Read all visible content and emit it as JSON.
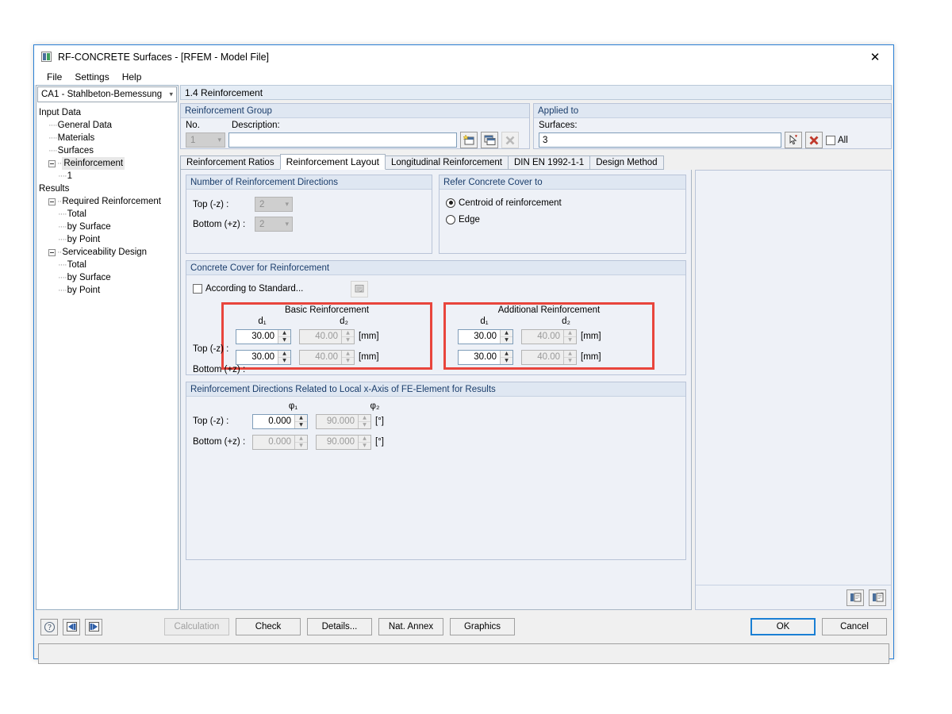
{
  "window": {
    "title": "RF-CONCRETE Surfaces - [RFEM - Model File]",
    "close_label": "✕",
    "icon": "app-icon"
  },
  "menu": {
    "items": [
      "File",
      "Settings",
      "Help"
    ]
  },
  "sidebar": {
    "combo_value": "CA1 - Stahlbeton-Bemessung",
    "tree": [
      {
        "label": "Input Data",
        "depth": 0,
        "expander": false,
        "dash": false,
        "selected": false
      },
      {
        "label": "General Data",
        "depth": 1,
        "expander": false,
        "dash": true,
        "selected": false
      },
      {
        "label": "Materials",
        "depth": 1,
        "expander": false,
        "dash": true,
        "selected": false
      },
      {
        "label": "Surfaces",
        "depth": 1,
        "expander": false,
        "dash": true,
        "selected": false
      },
      {
        "label": "Reinforcement",
        "depth": 1,
        "expander": true,
        "dash": true,
        "selected": true
      },
      {
        "label": "1",
        "depth": 2,
        "expander": false,
        "dash": true,
        "selected": false
      },
      {
        "label": "Results",
        "depth": 0,
        "expander": false,
        "dash": false,
        "selected": false
      },
      {
        "label": "Required Reinforcement",
        "depth": 1,
        "expander": true,
        "dash": true,
        "selected": false
      },
      {
        "label": "Total",
        "depth": 2,
        "expander": false,
        "dash": true,
        "selected": false
      },
      {
        "label": "by Surface",
        "depth": 2,
        "expander": false,
        "dash": true,
        "selected": false
      },
      {
        "label": "by Point",
        "depth": 2,
        "expander": false,
        "dash": true,
        "selected": false
      },
      {
        "label": "Serviceability Design",
        "depth": 1,
        "expander": true,
        "dash": true,
        "selected": false
      },
      {
        "label": "Total",
        "depth": 2,
        "expander": false,
        "dash": true,
        "selected": false
      },
      {
        "label": "by Surface",
        "depth": 2,
        "expander": false,
        "dash": true,
        "selected": false
      },
      {
        "label": "by Point",
        "depth": 2,
        "expander": false,
        "dash": true,
        "selected": false
      }
    ]
  },
  "page": {
    "title": "1.4 Reinforcement"
  },
  "reinforcement_group": {
    "title": "Reinforcement Group",
    "no_label": "No.",
    "no_value": "1",
    "description_label": "Description:",
    "description_value": "",
    "buttons": [
      "new-icon",
      "copy-icon",
      "delete-icon"
    ]
  },
  "applied_to": {
    "title": "Applied to",
    "surfaces_label": "Surfaces:",
    "surfaces_value": "3",
    "pick_icon": "pick-cursor-icon",
    "clear_icon": "red-x-icon",
    "all_label": "All",
    "all_checked": false
  },
  "tabs": [
    {
      "label": "Reinforcement Ratios",
      "active": false
    },
    {
      "label": "Reinforcement Layout",
      "active": true
    },
    {
      "label": "Longitudinal Reinforcement",
      "active": false
    },
    {
      "label": "DIN EN 1992-1-1",
      "active": false
    },
    {
      "label": "Design Method",
      "active": false
    }
  ],
  "directions": {
    "title": "Number of Reinforcement Directions",
    "rows": [
      {
        "label": "Top (-z) :",
        "value": "2",
        "enabled": false
      },
      {
        "label": "Bottom (+z) :",
        "value": "2",
        "enabled": false
      }
    ]
  },
  "refer_cover": {
    "title": "Refer Concrete Cover to",
    "options": [
      {
        "label": "Centroid of reinforcement",
        "selected": true
      },
      {
        "label": "Edge",
        "selected": false
      }
    ]
  },
  "concrete_cover": {
    "title": "Concrete Cover for Reinforcement",
    "standard_checkbox_label": "According to Standard...",
    "standard_checked": false,
    "standard_button_icon": "standard-settings-icon",
    "groups": [
      {
        "name": "Basic Reinforcement",
        "highlighted": true,
        "col1": "d₁",
        "col2": "d₂",
        "rows": [
          {
            "label": "Top (-z) :",
            "d1": "30.00",
            "d1_enabled": true,
            "d2": "40.00",
            "d2_enabled": false,
            "unit": "[mm]"
          },
          {
            "label": "Bottom (+z) :",
            "d1": "30.00",
            "d1_enabled": true,
            "d2": "40.00",
            "d2_enabled": false,
            "unit": "[mm]"
          }
        ]
      },
      {
        "name": "Additional Reinforcement",
        "highlighted": true,
        "col1": "d₁",
        "col2": "d₂",
        "rows": [
          {
            "label": "",
            "d1": "30.00",
            "d1_enabled": true,
            "d2": "40.00",
            "d2_enabled": false,
            "unit": "[mm]"
          },
          {
            "label": "",
            "d1": "30.00",
            "d1_enabled": true,
            "d2": "40.00",
            "d2_enabled": false,
            "unit": "[mm]"
          }
        ]
      }
    ]
  },
  "reinf_directions_local": {
    "title": "Reinforcement Directions Related to Local x-Axis of FE-Element for Results",
    "col1": "φ₁",
    "col2": "φ₂",
    "rows": [
      {
        "label": "Top (-z) :",
        "v1": "0.000",
        "v1_enabled": true,
        "v2": "90.000",
        "v2_enabled": false,
        "unit": "[°]"
      },
      {
        "label": "Bottom (+z) :",
        "v1": "0.000",
        "v1_enabled": false,
        "v2": "90.000",
        "v2_enabled": false,
        "unit": "[°]"
      }
    ]
  },
  "preview_footer_icons": [
    "export-table-icon",
    "print-table-icon"
  ],
  "footer": {
    "left_icons": [
      "help-icon",
      "previous-icon",
      "next-icon"
    ],
    "buttons": [
      {
        "label": "Calculation",
        "enabled": false,
        "focused": false
      },
      {
        "label": "Check",
        "enabled": true,
        "focused": false
      },
      {
        "label": "Details...",
        "enabled": true,
        "focused": false
      },
      {
        "label": "Nat. Annex",
        "enabled": true,
        "focused": false
      },
      {
        "label": "Graphics",
        "enabled": true,
        "focused": false
      }
    ],
    "ok_label": "OK",
    "cancel_label": "Cancel"
  },
  "colors": {
    "accent": "#2a7fd4",
    "highlight_red": "#e8453c",
    "group_title_text": "#1a3d6b",
    "panel_bg": "#eef1f7"
  }
}
